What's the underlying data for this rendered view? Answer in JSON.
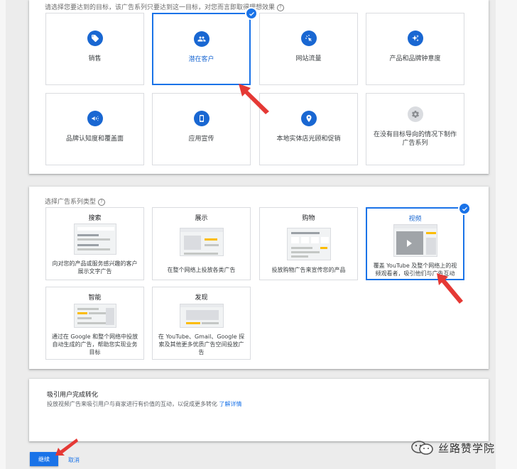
{
  "goals_section": {
    "hint": "请选择您要达到的目标，该广告系列只要达到这一目标，对您而言即取得理想效果",
    "goals": [
      {
        "label": "销售",
        "icon": "tag-icon"
      },
      {
        "label": "潜在客户",
        "icon": "people-icon",
        "selected": true
      },
      {
        "label": "网站流量",
        "icon": "cursor-click-icon"
      },
      {
        "label": "产品和品牌钟意度",
        "icon": "sparkle-icon"
      },
      {
        "label": "品牌认知度和覆盖面",
        "icon": "megaphone-icon"
      },
      {
        "label": "应用宣传",
        "icon": "smartphone-icon"
      },
      {
        "label": "本地实体店光顾和促销",
        "icon": "location-pin-icon"
      },
      {
        "label": "在没有目标导向的情况下制作广告系列",
        "icon": "gear-icon"
      }
    ]
  },
  "types_section": {
    "hint": "选择广告系列类型",
    "types": [
      {
        "title": "搜索",
        "desc": "向对您的产品或服务感兴趣的客户展示文字广告"
      },
      {
        "title": "展示",
        "desc": "在整个网络上投放各类广告"
      },
      {
        "title": "购物",
        "desc": "投放购物广告来宣传您的产品"
      },
      {
        "title": "视频",
        "desc": "覆盖 YouTube 及整个网络上的视频观看者，吸引他们与广告互动",
        "selected": true
      },
      {
        "title": "智能",
        "desc": "通过在 Google 和整个网络中投放自动生成的广告，帮助您实现业务目标"
      },
      {
        "title": "发现",
        "desc": "在 YouTube、Gmail、Google 探索及其他更多优质广告空间投放广告"
      }
    ]
  },
  "subtype_section": {
    "title": "吸引用户完成转化",
    "desc": "投放视频广告来吸引用户与商家进行有价值的互动，以促成更多转化",
    "link": "了解详情"
  },
  "actions": {
    "continue": "继续",
    "cancel": "取消"
  },
  "watermark": {
    "text": "丝路赞学院"
  },
  "colors": {
    "primary": "#1a73e8",
    "arrow": "#e53935"
  }
}
